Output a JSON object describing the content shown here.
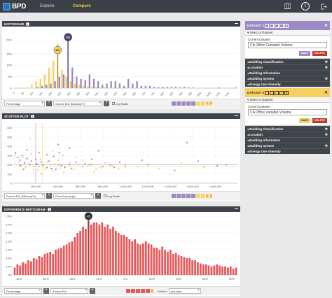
{
  "app": {
    "logo_text": "BPD",
    "nav": [
      "Explore",
      "Compare"
    ],
    "active_nav": "Compare",
    "icons": [
      "map-icon",
      "info-icon",
      "logout-icon"
    ],
    "info_glyph": "i"
  },
  "histogram": {
    "title": "HISTOGRAM",
    "info_glyph": "i",
    "controls": {
      "metric": "Percentage",
      "field": "Source EUI (kBtu/sq/Yr)",
      "log_label": "Log Scale",
      "legend_text_a": "1",
      "legend_text_b": "2"
    }
  },
  "scatter": {
    "title": "SCATTER PLOT",
    "info_glyph": "i",
    "controls": {
      "y_field": "Source EUI (kBtu/sq/Yr)",
      "x_field": "Floor Area (sqft)",
      "log_label": "Log Scale",
      "legend_text_a": "1",
      "legend_text_b": "2"
    }
  },
  "difference": {
    "title": "DIFFERENCE HISTOGRAM",
    "info_glyph": "i",
    "controls": {
      "metric": "Percentage",
      "field": "Source EUI",
      "legend_text": "2",
      "method_label": "Method",
      "method_value": "Actuarial"
    }
  },
  "colors": {
    "dataset1": "#9b8ac4",
    "dataset2": "#f5cf62",
    "difference": "#e8585b",
    "dark": "#3e4449"
  },
  "chart_data": [
    {
      "type": "bar",
      "title": "HISTOGRAM",
      "xlabel": "",
      "ylabel": "",
      "ylim": [
        0,
        25
      ],
      "y_ticks": [
        "0",
        "5%",
        "10%",
        "15%",
        "21%"
      ],
      "x_tick_labels": [
        "0",
        "50",
        "100",
        "150",
        "200",
        "250",
        "300",
        "350",
        "400",
        "450",
        "500",
        "550",
        "600",
        "650",
        "700",
        "750",
        "800",
        "850",
        "900",
        "950",
        "1000",
        "1050",
        "1100",
        "1150"
      ],
      "annotations": [
        {
          "label": "182",
          "series": "Dataset 2"
        },
        {
          "label": "231",
          "series": "Dataset 1"
        }
      ],
      "series": [
        {
          "values": [
            0,
            0,
            0,
            0.3,
            1.5,
            3,
            4,
            6,
            9,
            12,
            19,
            8,
            5,
            3,
            2,
            1.5,
            1,
            0.8,
            0.5,
            0.5,
            0.3,
            0.2,
            0.1,
            0,
            0,
            0,
            0,
            0,
            0,
            0,
            0,
            0,
            0,
            0,
            0,
            0,
            0,
            0,
            0,
            0,
            0,
            0,
            0,
            0,
            0,
            0,
            0,
            0,
            0,
            0,
            0,
            0
          ]
        },
        {
          "values": [
            0,
            0,
            0,
            0,
            0,
            0.5,
            1,
            1.5,
            2,
            3,
            5,
            6,
            21,
            9,
            5,
            4,
            3.5,
            6,
            4,
            3,
            1.5,
            2,
            3,
            3,
            2,
            1,
            4,
            2,
            3,
            1,
            1,
            1,
            0.5,
            0.5,
            0.5,
            0.5,
            0.5,
            0.5,
            0.3,
            0.5,
            0.3,
            0.3,
            0,
            0,
            0,
            0,
            0,
            0.3,
            0,
            0,
            0,
            0.3
          ]
        }
      ]
    },
    {
      "type": "scatter",
      "title": "SCATTER PLOT",
      "xlabel": "",
      "ylabel": "",
      "xlim": [
        0,
        2000000
      ],
      "ylim": [
        0,
        650
      ],
      "y_ticks": [
        "0",
        "100",
        "200",
        "300",
        "400",
        "500",
        "600"
      ],
      "x_tick_labels": [
        "200,000",
        "400,000",
        "600,000",
        "800,000",
        "1,000,000",
        "1,200,000",
        "1,400,000",
        "1,600,000",
        "1,800,000"
      ],
      "series": [
        {
          "points": [
            [
              20000,
              330
            ],
            [
              40000,
              280
            ],
            [
              60000,
              250
            ],
            [
              80000,
              300
            ],
            [
              100000,
              220
            ],
            [
              120000,
              270
            ],
            [
              150000,
              200
            ],
            [
              160000,
              240
            ],
            [
              180000,
              180
            ],
            [
              200000,
              260
            ],
            [
              210000,
              210
            ],
            [
              230000,
              180
            ],
            [
              250000,
              230
            ],
            [
              270000,
              200
            ],
            [
              300000,
              170
            ],
            [
              320000,
              240
            ],
            [
              340000,
              160
            ],
            [
              360000,
              290
            ],
            [
              380000,
              150
            ],
            [
              400000,
              420
            ],
            [
              410000,
              200
            ],
            [
              430000,
              190
            ],
            [
              460000,
              170
            ],
            [
              500000,
              200
            ],
            [
              520000,
              160
            ],
            [
              560000,
              230
            ],
            [
              620000,
              180
            ],
            [
              680000,
              200
            ],
            [
              760000,
              350
            ],
            [
              800000,
              180
            ],
            [
              860000,
              200
            ],
            [
              900000,
              170
            ],
            [
              1000000,
              180
            ],
            [
              1200000,
              200
            ],
            [
              1440000,
              140
            ],
            [
              1650000,
              240
            ],
            [
              1820000,
              190
            ],
            [
              1900000,
              200
            ],
            [
              1550000,
              440
            ],
            [
              1150000,
              250
            ],
            [
              950000,
              230
            ],
            [
              700000,
              260
            ],
            [
              500000,
              380
            ],
            [
              300000,
              310
            ],
            [
              120000,
              360
            ],
            [
              90000,
              150
            ],
            [
              60000,
              190
            ],
            [
              230000,
              330
            ],
            [
              410000,
              330
            ],
            [
              640000,
              210
            ]
          ]
        },
        {
          "points": [
            [
              20000,
              300
            ],
            [
              50000,
              230
            ],
            [
              70000,
              200
            ],
            [
              90000,
              280
            ],
            [
              110000,
              170
            ],
            [
              140000,
              220
            ],
            [
              160000,
              320
            ],
            [
              180000,
              150
            ],
            [
              200000,
              200
            ],
            [
              220000,
              140
            ],
            [
              240000,
              260
            ],
            [
              260000,
              190
            ],
            [
              280000,
              150
            ],
            [
              300000,
              230
            ],
            [
              330000,
              200
            ],
            [
              350000,
              140
            ],
            [
              370000,
              210
            ],
            [
              400000,
              250
            ],
            [
              420000,
              160
            ],
            [
              440000,
              300
            ],
            [
              460000,
              180
            ],
            [
              500000,
              220
            ],
            [
              540000,
              150
            ],
            [
              580000,
              200
            ],
            [
              620000,
              250
            ],
            [
              660000,
              180
            ],
            [
              700000,
              210
            ],
            [
              740000,
              150
            ],
            [
              780000,
              170
            ],
            [
              820000,
              220
            ],
            [
              880000,
              190
            ],
            [
              940000,
              160
            ],
            [
              1000000,
              200
            ],
            [
              1100000,
              180
            ],
            [
              1300000,
              160
            ],
            [
              1500000,
              220
            ],
            [
              1700000,
              170
            ],
            [
              150000,
              480
            ],
            [
              350000,
              350
            ],
            [
              450000,
              120
            ],
            [
              250000,
              100
            ],
            [
              130000,
              260
            ],
            [
              560000,
              280
            ],
            [
              720000,
              120
            ]
          ]
        }
      ]
    },
    {
      "type": "bar",
      "title": "DIFFERENCE HISTOGRAM",
      "xlabel": "",
      "ylabel": "",
      "ylim": [
        0,
        2.8
      ],
      "y_ticks": [
        "0%",
        "0.4%",
        "0.8%",
        "1.2%",
        "1.6%",
        "2.0%",
        "2.4%",
        "2.8%"
      ],
      "x_tick_labels": [
        "-80%",
        "-60%",
        "-40%",
        "-20%",
        "0%",
        "20%",
        "40%",
        "60%",
        "80%"
      ],
      "annotations": [
        {
          "label": "-21"
        }
      ],
      "values": [
        0.35,
        0.5,
        0.45,
        0.6,
        0.55,
        0.7,
        0.65,
        0.8,
        0.75,
        0.9,
        0.85,
        1.0,
        1.05,
        1.1,
        1.0,
        1.2,
        1.25,
        1.3,
        1.4,
        1.45,
        1.55,
        1.6,
        1.8,
        2.0,
        2.1,
        2.3,
        2.2,
        2.6,
        2.4,
        2.5,
        2.5,
        2.4,
        2.5,
        2.3,
        2.4,
        2.2,
        2.3,
        2.1,
        2.0,
        1.9,
        1.9,
        1.8,
        1.7,
        1.6,
        1.7,
        1.5,
        1.45,
        1.5,
        1.6,
        1.5,
        1.45,
        1.3,
        1.3,
        1.2,
        1.35,
        1.2,
        1.1,
        1.2,
        1.0,
        1.05,
        0.95,
        0.9,
        0.85,
        0.8,
        0.8,
        0.7,
        0.7,
        0.6,
        0.55,
        0.5,
        0.5,
        0.45,
        0.4,
        0.45,
        0.5,
        0.45,
        0.4,
        0.4,
        0.35,
        0.4,
        0.3,
        0.35
      ]
    }
  ],
  "sidebar": {
    "dataset1": {
      "title": "DATASET 1",
      "boxes": [
        "",
        "",
        "",
        "",
        "5"
      ],
      "select_label": "Select a Dataset",
      "current_label": "Current Dataset",
      "current_value": "CA Office Constant Volume",
      "save_label": "SAVE",
      "delete_label": "DELETE",
      "categories": [
        "Building Classification",
        "Location",
        "Building Information",
        "Building System",
        "Energy Use Intensity"
      ]
    },
    "dataset2": {
      "title": "DATASET 2",
      "boxes": [
        "",
        "",
        "",
        "",
        "5"
      ],
      "select_label": "Select a Dataset",
      "current_label": "Current Dataset",
      "current_value": "CA Office Variable Volume",
      "save_label": "SAVE",
      "delete_label": "DELETE",
      "categories": [
        "Building Classification",
        "Location",
        "Building Information",
        "Building System",
        "Energy Use Intensity"
      ]
    }
  }
}
